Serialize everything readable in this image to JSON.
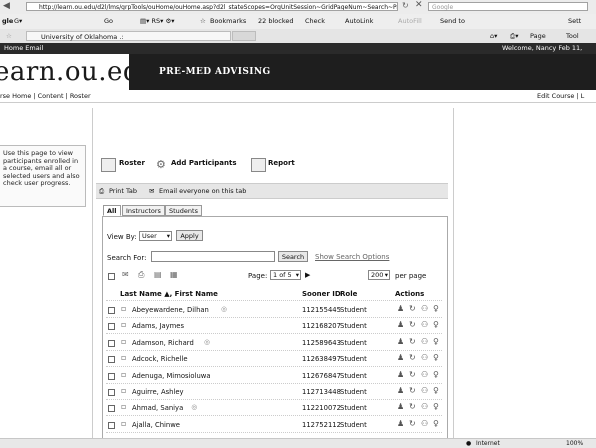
{
  "browser": {
    "address": "http://learn.ou.edu/d2l/lms/grpTools/ouHome/ouHome.asp?d2l_stateScopes=OrgUnitSession~GridPageNum~Search~PageNum",
    "search_placeholder": "Google",
    "google_label": "gle",
    "toolbar": {
      "go": "Go",
      "bookmarks": "Bookmarks",
      "blocked": "22 blocked",
      "check": "Check",
      "autolink": "AutoLink",
      "autofill": "AutoFill",
      "send_to": "Send to",
      "settings": "Sett",
      "page": "Page",
      "tools": "Tool"
    },
    "tab_title": "University of Oklahoma .:",
    "status_zone": "Internet",
    "zoom": "100%"
  },
  "site": {
    "top_links": "Home   Email",
    "welcome": "Welcome, Nancy  Feb 11,",
    "logo": "earn.ou.edu",
    "course_title": "PRE-MED ADVISING",
    "nav": "rse Home | Content | Roster",
    "edit_course": "Edit Course | L"
  },
  "help_text": "Use this page to view participants enrolled in a course, email all or selected users and also check user progress.",
  "roster_tabs": {
    "roster": "Roster",
    "add_participants": "Add Participants",
    "report": "Report"
  },
  "actions": {
    "print_tab": "Print Tab",
    "email_everyone": "Email everyone on this tab"
  },
  "filter_tabs": [
    "All",
    "Instructors",
    "Students"
  ],
  "view_by": {
    "label": "View By:",
    "value": "User",
    "apply": "Apply"
  },
  "search": {
    "label": "Search For:",
    "button": "Search",
    "show_options": "Show Search Options"
  },
  "paging": {
    "page_label": "Page:",
    "page_value": "1 of 5",
    "per_page_value": "200",
    "per_page_label": "per page"
  },
  "columns": {
    "name": "Last Name ▲, First Name",
    "id": "Sooner ID",
    "role": "Role",
    "actions": "Actions"
  },
  "rows": [
    {
      "name": "Abeyewardene, Dilhan",
      "id": "112155445",
      "role": "Student",
      "online": true
    },
    {
      "name": "Adams, Jaymes",
      "id": "112168207",
      "role": "Student",
      "online": false
    },
    {
      "name": "Adamson, Richard",
      "id": "112589643",
      "role": "Student",
      "online": true
    },
    {
      "name": "Adcock, Richelle",
      "id": "112638497",
      "role": "Student",
      "online": false
    },
    {
      "name": "Adenuga, Mimosioluwa",
      "id": "112676847",
      "role": "Student",
      "online": false
    },
    {
      "name": "Aguirre, Ashley",
      "id": "112713448",
      "role": "Student",
      "online": false
    },
    {
      "name": "Ahmad, Saniya",
      "id": "112210072",
      "role": "Student",
      "online": true
    },
    {
      "name": "Ajalla, Chinwe",
      "id": "112752112",
      "role": "Student",
      "online": false
    }
  ]
}
